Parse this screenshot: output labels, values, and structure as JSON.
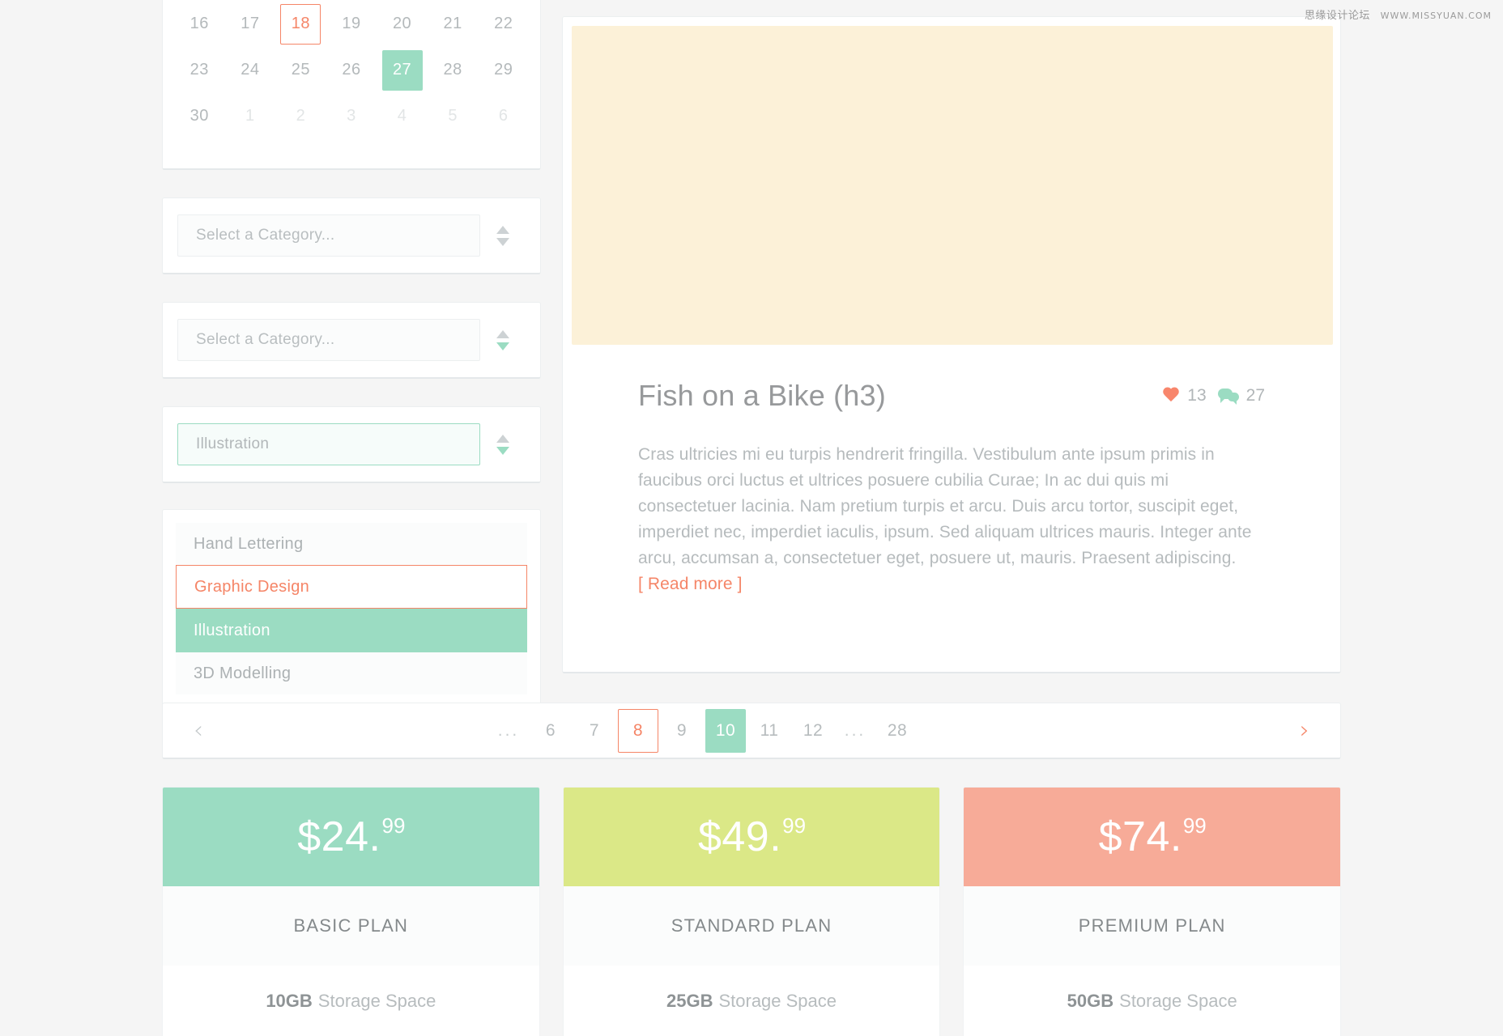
{
  "watermark": {
    "cn": "思缘设计论坛",
    "url": "WWW.MISSYUAN.COM"
  },
  "colors": {
    "coral": "#f58567",
    "mint": "#9bdcc2",
    "lime": "#dbe887",
    "salmon": "#f7ab98",
    "cream": "#fcf1d8",
    "text_muted": "#b4b9bb"
  },
  "calendar": {
    "weeks": [
      [
        {
          "label": "16",
          "state": "normal"
        },
        {
          "label": "17",
          "state": "normal"
        },
        {
          "label": "18",
          "state": "outline"
        },
        {
          "label": "19",
          "state": "normal"
        },
        {
          "label": "20",
          "state": "normal"
        },
        {
          "label": "21",
          "state": "normal"
        },
        {
          "label": "22",
          "state": "normal"
        }
      ],
      [
        {
          "label": "23",
          "state": "normal"
        },
        {
          "label": "24",
          "state": "normal"
        },
        {
          "label": "25",
          "state": "normal"
        },
        {
          "label": "26",
          "state": "normal"
        },
        {
          "label": "27",
          "state": "filled"
        },
        {
          "label": "28",
          "state": "normal"
        },
        {
          "label": "29",
          "state": "normal"
        }
      ],
      [
        {
          "label": "30",
          "state": "normal"
        },
        {
          "label": "1",
          "state": "muted"
        },
        {
          "label": "2",
          "state": "muted"
        },
        {
          "label": "3",
          "state": "muted"
        },
        {
          "label": "4",
          "state": "muted"
        },
        {
          "label": "5",
          "state": "muted"
        },
        {
          "label": "6",
          "state": "muted"
        }
      ]
    ]
  },
  "selects": [
    {
      "value": "Select a Category...",
      "placeholder": "Select a Category...",
      "state": "default",
      "down_arrow": "gray"
    },
    {
      "value": "Select a Category...",
      "placeholder": "Select a Category...",
      "state": "default",
      "down_arrow": "green"
    },
    {
      "value": "Illustration",
      "placeholder": "Select a Category...",
      "state": "active",
      "down_arrow": "green"
    }
  ],
  "option_list": [
    {
      "label": "Hand Lettering",
      "state": "normal"
    },
    {
      "label": "Graphic Design",
      "state": "outline"
    },
    {
      "label": "Illustration",
      "state": "filled"
    },
    {
      "label": "3D Modelling",
      "state": "normal"
    }
  ],
  "article": {
    "title": "Fish on a Bike (h3)",
    "likes": "13",
    "comments": "27",
    "body": "Cras ultricies mi eu turpis hendrerit fringilla. Vestibulum ante ipsum primis in faucibus orci luctus et ultrices posuere cubilia Curae; In ac dui quis mi consectetuer lacinia. Nam pretium turpis et arcu. Duis arcu tortor, suscipit eget, imperdiet nec, imperdiet iaculis, ipsum. Sed aliquam ultrices mauris. Integer ante arcu, accumsan a, consectetuer eget, posuere ut, mauris. Praesent adipiscing.",
    "read_more": "[ Read more ]"
  },
  "pagination": {
    "prev": "‹",
    "next": "›",
    "items": [
      {
        "label": "...",
        "state": "dots"
      },
      {
        "label": "6",
        "state": "normal"
      },
      {
        "label": "7",
        "state": "normal"
      },
      {
        "label": "8",
        "state": "outline"
      },
      {
        "label": "9",
        "state": "normal"
      },
      {
        "label": "10",
        "state": "filled"
      },
      {
        "label": "11",
        "state": "normal"
      },
      {
        "label": "12",
        "state": "normal"
      },
      {
        "label": "...",
        "state": "dots"
      },
      {
        "label": "28",
        "state": "normal"
      }
    ]
  },
  "pricing": [
    {
      "price_main": "$24.",
      "price_cents": "99",
      "name": "BASIC PLAN",
      "storage_amount": "10GB",
      "storage_label": "Storage Space",
      "header_color": "#9bdcc2"
    },
    {
      "price_main": "$49.",
      "price_cents": "99",
      "name": "STANDARD PLAN",
      "storage_amount": "25GB",
      "storage_label": "Storage Space",
      "header_color": "#dbe887"
    },
    {
      "price_main": "$74.",
      "price_cents": "99",
      "name": "PREMIUM PLAN",
      "storage_amount": "50GB",
      "storage_label": "Storage Space",
      "header_color": "#f7ab98"
    }
  ]
}
